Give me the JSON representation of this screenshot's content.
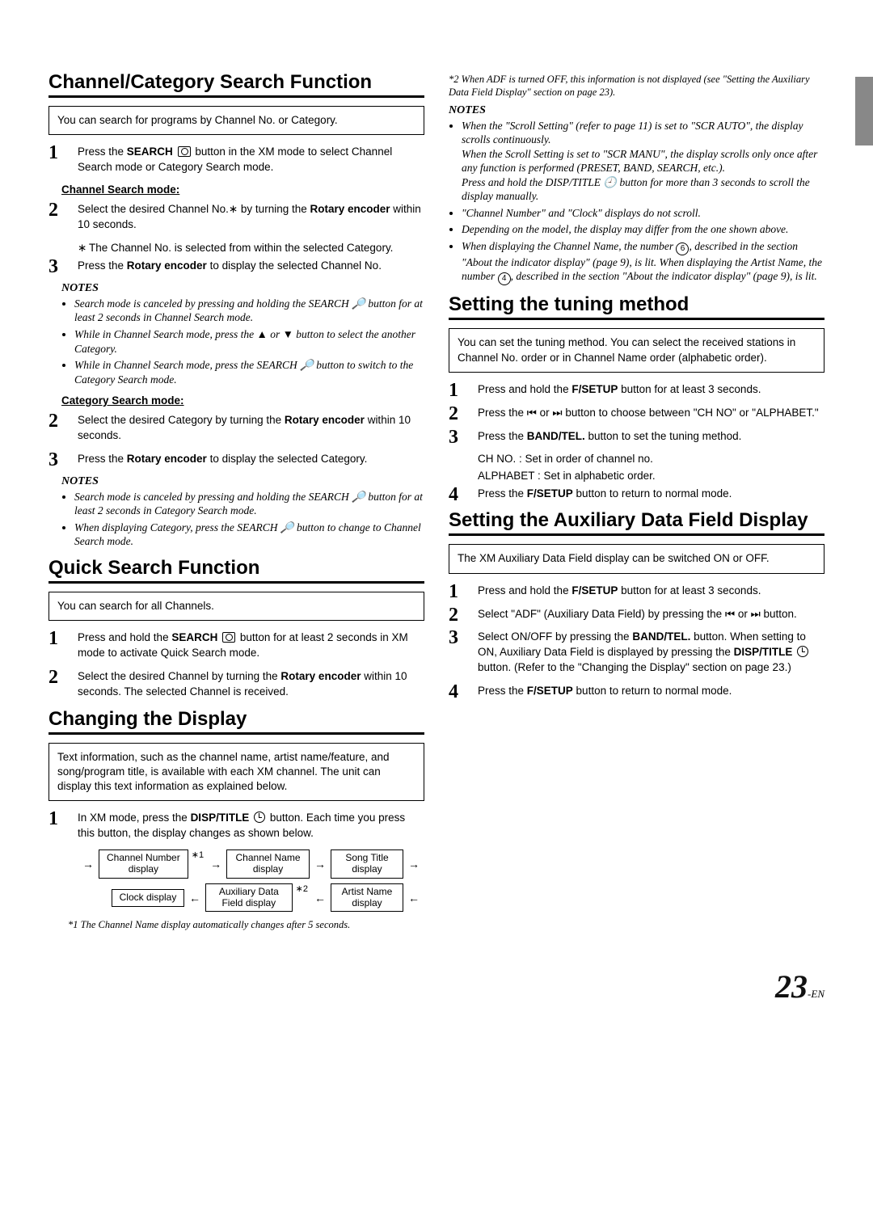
{
  "page_number": "23",
  "page_suffix": "-EN",
  "left": {
    "sectionA": {
      "title": "Channel/Category Search Function",
      "intro": "You can search for programs by Channel No. or Category.",
      "step1_pre": "Press the ",
      "step1_bold": "SEARCH",
      "step1_post": " button in the XM mode to select Channel Search mode or Category Search mode.",
      "ch_search_label": "Channel Search mode:",
      "ch_step2_a": "Select the desired Channel No.∗ by turning the ",
      "ch_step2_bold": "Rotary encoder",
      "ch_step2_b": " within 10 seconds.",
      "ch_step2_note": "The Channel No. is selected from within the selected Category.",
      "ch_step3_a": "Press the ",
      "ch_step3_bold": "Rotary encoder",
      "ch_step3_b": " to display the selected Channel No.",
      "notes_label": "NOTES",
      "ch_notes": [
        "Search mode is canceled by pressing and holding the SEARCH 🔎 button for at least 2 seconds in Channel Search mode.",
        "While in Channel Search mode, press the ▲ or ▼ button to select the another Category.",
        "While in Channel Search mode, press the SEARCH 🔎 button to switch to the Category Search mode."
      ],
      "cat_search_label": "Category Search mode:",
      "cat_step2_a": "Select the desired Category by turning the ",
      "cat_step2_bold": "Rotary encoder",
      "cat_step2_b": " within 10 seconds.",
      "cat_step3_a": "Press the ",
      "cat_step3_bold": "Rotary encoder",
      "cat_step3_b": " to display the selected Category.",
      "cat_notes": [
        "Search mode is canceled by pressing and holding the SEARCH 🔎 button for at least 2 seconds in Category Search mode.",
        "When displaying Category, press the SEARCH 🔎 button to change to Channel Search mode."
      ]
    },
    "sectionB": {
      "title": "Quick Search Function",
      "intro": "You can search for all Channels.",
      "step1_a": "Press and hold the ",
      "step1_bold": "SEARCH",
      "step1_b": " button for at least 2 seconds in XM mode to activate Quick Search mode.",
      "step2_a": "Select the desired Channel by turning the ",
      "step2_bold": "Rotary encoder",
      "step2_b": " within 10 seconds. The selected Channel is received."
    },
    "sectionC": {
      "title": "Changing the Display",
      "intro": "Text information, such as the channel name, artist name/feature, and song/program title, is available with each XM channel. The unit can display this text information as explained below.",
      "step1_a": "In XM mode, press the ",
      "step1_bold": "DISP/TITLE",
      "step1_b": " button. Each time you press this button, the display changes as shown below.",
      "flow": {
        "r1": [
          "Channel Number display",
          "Channel Name display",
          "Song Title display"
        ],
        "r2": [
          "Clock display",
          "Auxiliary Data Field display",
          "Artist Name display"
        ],
        "a1": "∗1",
        "a2": "∗2"
      },
      "footnote1": "*1 The Channel Name display automatically changes after 5 seconds."
    }
  },
  "right": {
    "footnote2": "*2 When ADF is turned OFF, this information is not displayed (see \"Setting the Auxiliary Data Field Display\" section on page 23).",
    "notes_label": "NOTES",
    "top_notes": {
      "n0": "When the \"Scroll Setting\" (refer to page 11) is set to \"SCR AUTO\", the display scrolls continuously.",
      "n0b": "When the Scroll Setting is set to \"SCR MANU\", the display scrolls only once after any function is performed (PRESET, BAND, SEARCH, etc.).",
      "n0c": "Press and hold the DISP/TITLE 🕘 button for more than 3 seconds to scroll the display manually.",
      "n1": "\"Channel Number\" and \"Clock\" displays do not scroll.",
      "n2": "Depending on the model, the display may differ from the one shown above.",
      "n3a": "When displaying the Channel Name, the number ",
      "n3_num1": "6",
      "n3b": ", described in the section \"About the indicator display\" (page 9), is lit. When displaying the Artist Name, the number ",
      "n3_num2": "4",
      "n3c": ", described in the section \"About the indicator display\" (page 9), is lit."
    },
    "sectionD": {
      "title": "Setting the tuning method",
      "intro": "You can set the tuning method. You can select the received stations in Channel No. order or in Channel Name order (alphabetic order).",
      "step1_a": "Press and hold the ",
      "step1_bold": "F/SETUP",
      "step1_b": " button for at least 3 seconds.",
      "step2": "Press the ⏮ or ⏭ button to choose between \"CH NO\" or \"ALPHABET.\"",
      "step3_a": "Press the ",
      "step3_bold": "BAND/TEL.",
      "step3_b": " button to set the tuning method.",
      "line_ch": "CH NO. : Set in order of channel no.",
      "line_alpha": "ALPHABET : Set in alphabetic order.",
      "step4_a": "Press the ",
      "step4_bold": "F/SETUP",
      "step4_b": " button to return to normal mode."
    },
    "sectionE": {
      "title": "Setting the Auxiliary Data Field Display",
      "intro": "The XM Auxiliary Data Field display can be switched ON or OFF.",
      "step1_a": "Press and hold the ",
      "step1_bold": "F/SETUP",
      "step1_b": " button for at least 3 seconds.",
      "step2": "Select \"ADF\" (Auxiliary Data Field) by pressing the ⏮ or ⏭ button.",
      "step3_a": "Select ON/OFF by pressing the ",
      "step3_bold": "BAND/TEL.",
      "step3_b": " button. When setting to ON, Auxiliary Data Field is displayed by pressing the ",
      "step3_bold2": "DISP/TITLE",
      "step3_c": " button. (Refer to the \"Changing the Display\" section on page 23.)",
      "step4_a": "Press the ",
      "step4_bold": "F/SETUP",
      "step4_b": " button to return to normal mode."
    }
  }
}
